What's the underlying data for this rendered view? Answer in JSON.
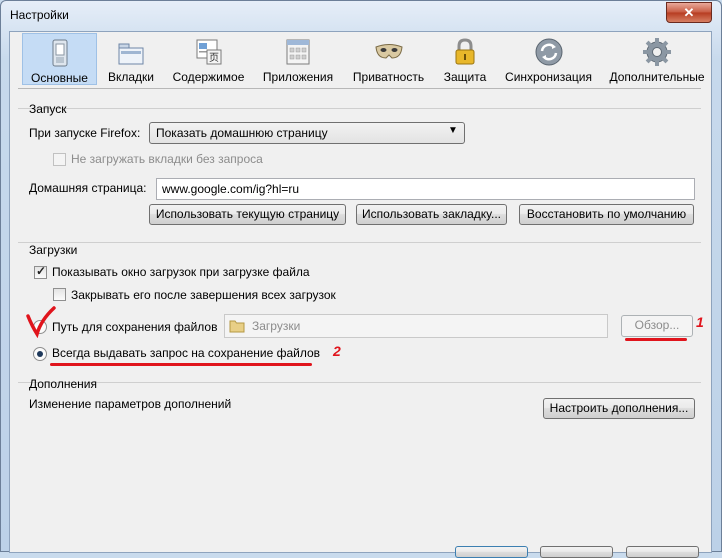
{
  "window": {
    "title": "Настройки",
    "close_glyph": "✕"
  },
  "tabs": [
    {
      "label": "Основные",
      "icon": "main-switch-icon",
      "selected": true
    },
    {
      "label": "Вкладки",
      "icon": "tabs-icon"
    },
    {
      "label": "Содержимое",
      "icon": "content-icon"
    },
    {
      "label": "Приложения",
      "icon": "applications-icon"
    },
    {
      "label": "Приватность",
      "icon": "privacy-mask-icon"
    },
    {
      "label": "Защита",
      "icon": "lock-icon"
    },
    {
      "label": "Синхронизация",
      "icon": "sync-icon"
    },
    {
      "label": "Дополнительные",
      "icon": "gear-icon"
    }
  ],
  "startup": {
    "section": "Запуск",
    "on_start_label": "При запуске Firefox:",
    "on_start_value": "Показать домашнюю страницу",
    "dont_load_tabs": "Не загружать вкладки без запроса",
    "homepage_label": "Домашняя страница:",
    "homepage_value": "www.google.com/ig?hl=ru",
    "btn_current": "Использовать текущую страницу",
    "btn_bookmark": "Использовать закладку...",
    "btn_restore": "Восстановить по умолчанию"
  },
  "downloads": {
    "section": "Загрузки",
    "show_window": "Показывать окно загрузок при загрузке файла",
    "show_window_checked": true,
    "close_after": "Закрывать его после завершения всех загрузок",
    "close_after_checked": false,
    "save_path_label": "Путь для сохранения файлов",
    "save_path_value": "Загрузки",
    "browse": "Обзор...",
    "always_ask": "Всегда выдавать запрос на сохранение файлов",
    "selected_option": "always_ask",
    "annotation_1": "1",
    "annotation_2": "2"
  },
  "addons": {
    "section": "Дополнения",
    "desc": "Изменение параметров дополнений",
    "btn": "Настроить дополнения..."
  },
  "colors": {
    "selection": "#c5dcf5",
    "annotation_red": "#e0141c"
  }
}
